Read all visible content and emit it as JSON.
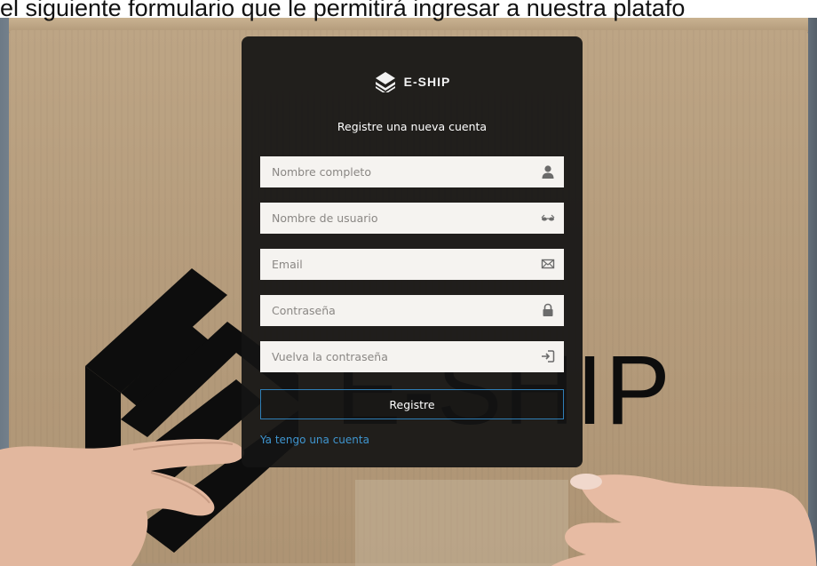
{
  "caption": {
    "text": "el siguiente formulario que le permitirá ingresar a nuestra platafo"
  },
  "background": {
    "printed_brand_text": "E-SHIP"
  },
  "card": {
    "brand_name": "E-SHIP",
    "title": "Registre una nueva cuenta",
    "fields": [
      {
        "placeholder": "Nombre completo",
        "value": "",
        "icon": "user-icon"
      },
      {
        "placeholder": "Nombre de usuario",
        "value": "",
        "icon": "glasses-icon"
      },
      {
        "placeholder": "Email",
        "value": "",
        "icon": "envelope-icon"
      },
      {
        "placeholder": "Contraseña",
        "value": "",
        "icon": "lock-icon"
      },
      {
        "placeholder": "Vuelva la contraseña",
        "value": "",
        "icon": "sign-in-icon"
      }
    ],
    "submit_label": "Registre",
    "login_link": "Ya tengo una cuenta"
  },
  "colors": {
    "card_background": "#141414",
    "button_border": "#2f7fb7",
    "link": "#3f95cf",
    "field_background": "#f5f3f0"
  }
}
